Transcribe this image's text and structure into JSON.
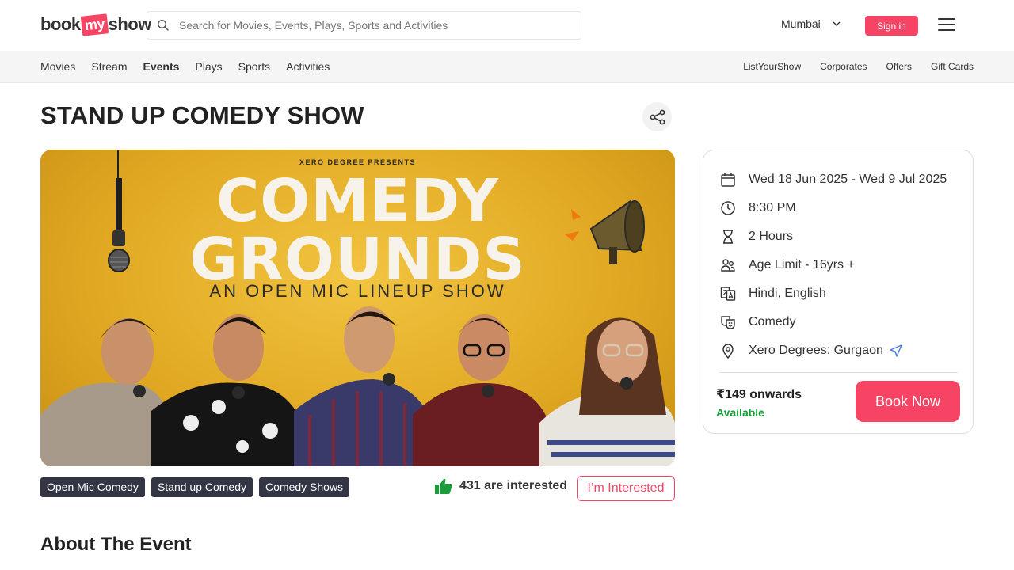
{
  "header": {
    "logo": {
      "part1": "book",
      "part2": "my",
      "part3": "show"
    },
    "search_placeholder": "Search for Movies, Events, Plays, Sports and Activities",
    "city": "Mumbai",
    "signin_label": "Sign in"
  },
  "subnav": {
    "left": [
      "Movies",
      "Stream",
      "Events",
      "Plays",
      "Sports",
      "Activities"
    ],
    "active": "Events",
    "right": [
      "ListYourShow",
      "Corporates",
      "Offers",
      "Gift Cards"
    ]
  },
  "event": {
    "title": "STAND UP COMEDY SHOW",
    "banner": {
      "presents": "XERO DEGREE PRESENTS",
      "line1": "COMEDY",
      "line2": "GROUNDS",
      "subline": "AN OPEN MIC LINEUP SHOW"
    },
    "tags": [
      "Open Mic Comedy",
      "Stand up Comedy",
      "Comedy Shows"
    ],
    "interested_text": "431 are interested",
    "interested_button": "I’m Interested",
    "about_heading": "About The Event"
  },
  "details": {
    "dates": "Wed 18 Jun 2025 - Wed 9 Jul 2025",
    "time": "8:30 PM",
    "duration": "2 Hours",
    "age_limit": "Age Limit - 16yrs +",
    "languages": "Hindi, English",
    "genre": "Comedy",
    "venue": "Xero Degrees: Gurgaon",
    "price": "₹149 onwards",
    "availability": "Available",
    "book_button": "Book Now"
  },
  "colors": {
    "brand": "#f84464",
    "available": "#1a9c3b",
    "tag_bg": "#333545",
    "banner_yellow": "#e2aa24"
  }
}
